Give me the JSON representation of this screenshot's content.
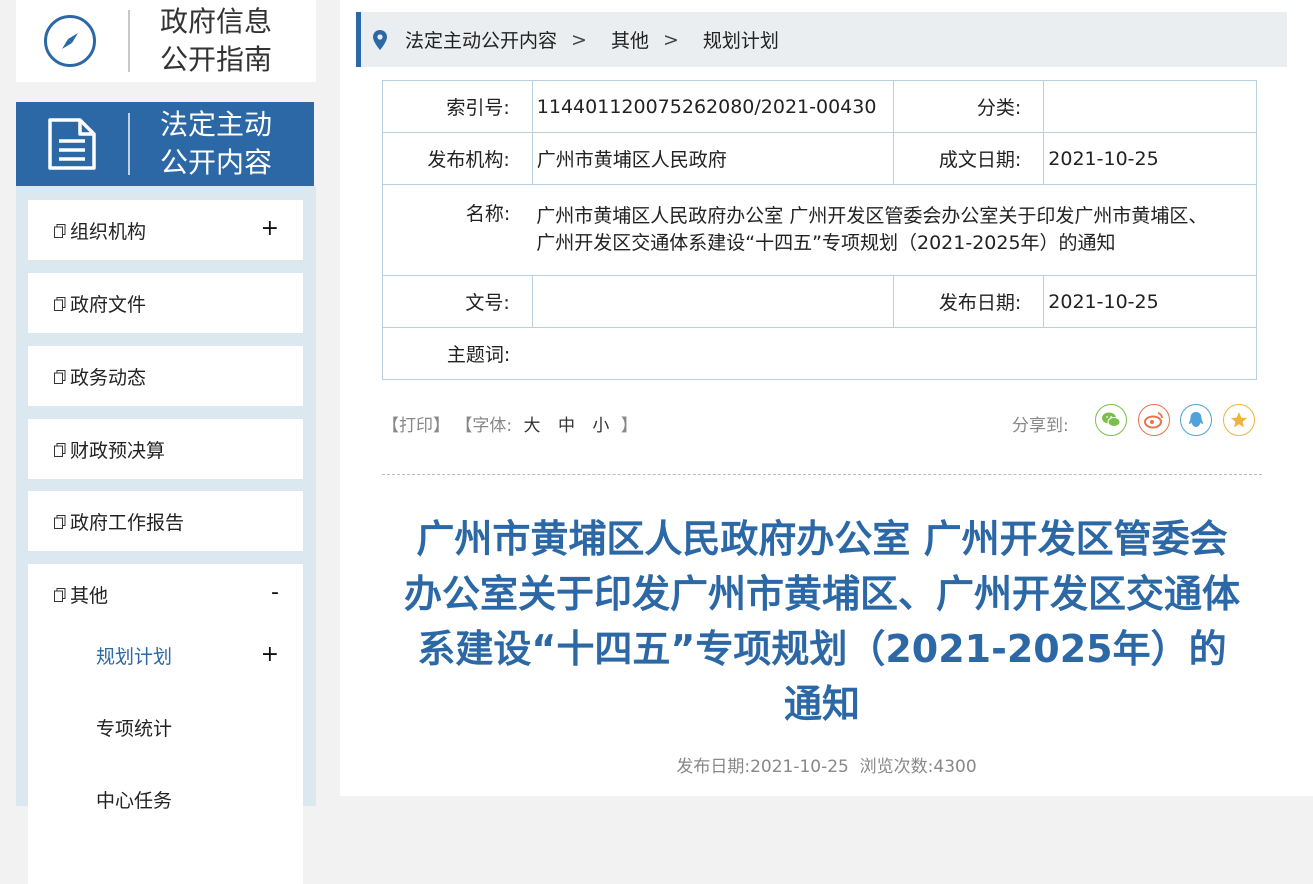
{
  "guide": {
    "title_line1": "政府信息",
    "title_line2": "公开指南",
    "icon": "compass-icon"
  },
  "active_category": {
    "title_line1": "法定主动",
    "title_line2": "公开内容",
    "icon": "document-icon"
  },
  "side_nav": {
    "items": [
      {
        "label": "组织机构",
        "toggle": "+"
      },
      {
        "label": "政府文件",
        "toggle": ""
      },
      {
        "label": "政务动态",
        "toggle": ""
      },
      {
        "label": "财政预决算",
        "toggle": ""
      },
      {
        "label": "政府工作报告",
        "toggle": ""
      }
    ],
    "open_item": {
      "label": "其他",
      "toggle": "-",
      "subitems": [
        {
          "label": "规划计划",
          "toggle": "+"
        },
        {
          "label": "专项统计",
          "toggle": ""
        },
        {
          "label": "中心任务",
          "toggle": ""
        }
      ]
    }
  },
  "breadcrumb": {
    "icon": "location-pin-icon",
    "items": [
      "法定主动公开内容",
      "其他",
      "规划计划"
    ],
    "separator": ">"
  },
  "meta": {
    "index_label": "索引号:",
    "index_value": "11440112007526208​0/2021-00430",
    "category_label": "分类:",
    "category_value": "",
    "publisher_label": "发布机构:",
    "publisher_value": "广州市黄埔区人民政府",
    "written_date_label": "成文日期:",
    "written_date_value": "2021-10-25",
    "name_label": "名称:",
    "name_value_line1": "广州市黄埔区人民政府办公室 广州开发区管委会办公室关于印发广州市黄埔区、",
    "name_value_line2": "广州开发区交通体系建设“十四五”专项规划（2021-2025年）的通知",
    "doc_no_label": "文号:",
    "doc_no_value": "",
    "publish_date_label": "发布日期:",
    "publish_date_value": "2021-10-25",
    "keywords_label": "主题词:",
    "keywords_value": ""
  },
  "toolbar": {
    "print": "【打印】",
    "font_open": "【字体:",
    "font_large": "大",
    "font_medium": "中",
    "font_small": "小",
    "font_close": "】",
    "share_label": "分享到:",
    "share_icons": [
      "wechat-icon",
      "weibo-icon",
      "qq-icon",
      "qzone-icon"
    ],
    "share_colors": [
      "#7bbf4a",
      "#e8734a",
      "#4fa3d8",
      "#f0b43a"
    ]
  },
  "article": {
    "title_line1": "广州市黄埔区人民政府办公室 广州开发区管委会",
    "title_line2": "办公室关于印发广州市黄埔区、广州开发区交通体",
    "title_line3": "系建设“十四五”专项规划（2021-2025年）的",
    "title_line4": "通知",
    "pub_date_label": "发布日期:",
    "pub_date": "2021-10-25",
    "views_label": "浏览次数:",
    "views": "4300"
  },
  "colors": {
    "accent": "#2c68a6",
    "nav_bg": "#dbe8ef",
    "border": "#b8d0de"
  }
}
